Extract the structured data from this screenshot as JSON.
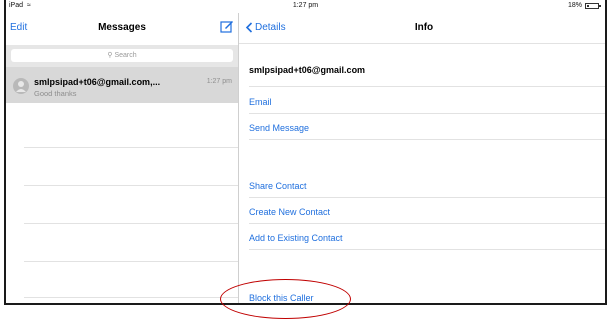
{
  "status": {
    "device": "iPad",
    "time": "1:27 pm",
    "battery": "18%",
    "battery_level": 0.18
  },
  "left_panel": {
    "edit_label": "Edit",
    "title": "Messages",
    "search_placeholder": "Search",
    "conversation": {
      "name": "smlpsipad+t06@gmail.com,...",
      "time": "1:27 pm",
      "preview": "Good thanks"
    }
  },
  "right_panel": {
    "back_label": "Details",
    "title": "Info",
    "contact_email": "smlpsipad+t06@gmail.com",
    "actions": {
      "email": "Email",
      "send_message": "Send Message",
      "share_contact": "Share Contact",
      "create_new_contact": "Create New Contact",
      "add_to_existing": "Add to Existing Contact",
      "block_caller": "Block this Caller"
    }
  },
  "colors": {
    "accent": "#1f6fde",
    "annotation": "#c00000",
    "selected_row": "#d8d8d8"
  },
  "icons": [
    "wifi-icon",
    "battery-icon",
    "compose-icon",
    "search-icon",
    "person-icon",
    "chevron-left-icon"
  ]
}
